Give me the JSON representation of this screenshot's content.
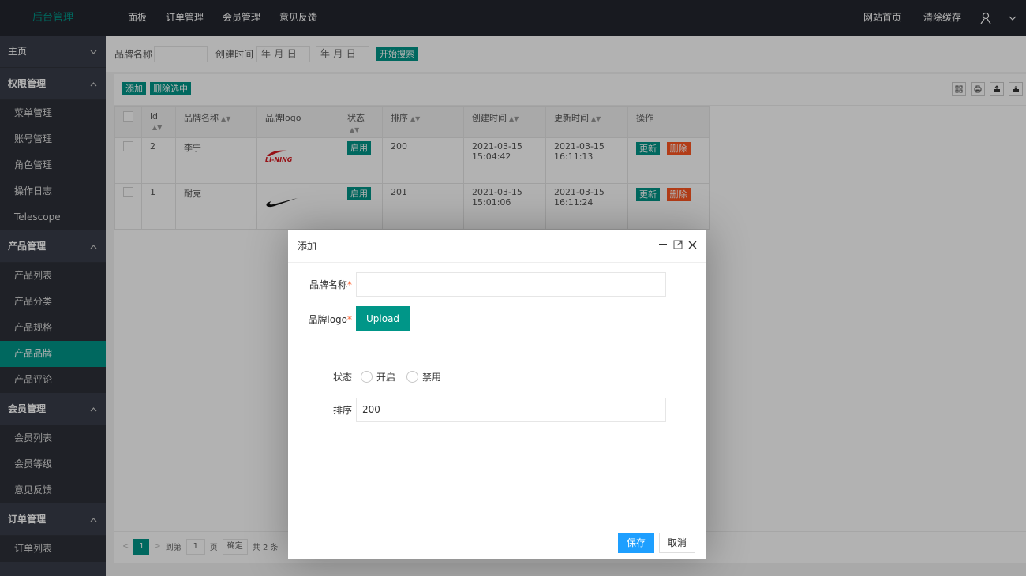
{
  "header": {
    "brand": "后台管理",
    "nav": [
      "面板",
      "订单管理",
      "会员管理",
      "意见反馈"
    ],
    "right_links": [
      "网站首页",
      "清除缓存"
    ]
  },
  "sidebar": {
    "home": "主页",
    "groups": [
      {
        "label": "权限管理",
        "items": [
          "菜单管理",
          "账号管理",
          "角色管理",
          "操作日志",
          "Telescope"
        ]
      },
      {
        "label": "产品管理",
        "items": [
          "产品列表",
          "产品分类",
          "产品规格",
          "产品品牌",
          "产品评论"
        ]
      },
      {
        "label": "会员管理",
        "items": [
          "会员列表",
          "会员等级",
          "意见反馈"
        ]
      },
      {
        "label": "订单管理",
        "items": [
          "订单列表"
        ]
      }
    ]
  },
  "search": {
    "name_label": "品牌名称",
    "name_value": "",
    "time_label": "创建时间",
    "date_placeholder_1": "年-月-日",
    "date_placeholder_2": "年-月-日",
    "search_button": "开始搜索"
  },
  "toolbar": {
    "add_label": "添加",
    "delete_selected_label": "删除选中"
  },
  "table": {
    "columns": [
      "id",
      "品牌名称",
      "品牌logo",
      "状态",
      "排序",
      "创建时间",
      "更新时间",
      "操作"
    ],
    "rows": [
      {
        "id": "2",
        "name": "李宁",
        "logo": "LI-NING",
        "status": "启用",
        "sort": "200",
        "created": "2021-03-15 15:04:42",
        "updated": "2021-03-15 16:11:13",
        "update_btn": "更新",
        "delete_btn": "删除"
      },
      {
        "id": "1",
        "name": "耐克",
        "logo": "nike-swoosh",
        "status": "启用",
        "sort": "201",
        "created": "2021-03-15 15:01:06",
        "updated": "2021-03-15 16:11:24",
        "update_btn": "更新",
        "delete_btn": "删除"
      }
    ]
  },
  "pager": {
    "current": "1",
    "goto_label": "到第",
    "page_value": "1",
    "page_unit": "页",
    "confirm": "确定",
    "total": "共 2 条"
  },
  "modal": {
    "title": "添加",
    "brand_name_label": "品牌名称",
    "brand_name_value": "",
    "logo_label": "品牌logo",
    "upload_label": "Upload",
    "status_label": "状态",
    "status_options": [
      "开启",
      "禁用"
    ],
    "sort_label": "排序",
    "sort_value": "200",
    "save_label": "保存",
    "cancel_label": "取消",
    "required_mark": "*"
  },
  "colors": {
    "accent": "#009688",
    "danger": "#ff5722",
    "primary": "#1e9fff",
    "sidebar_bg": "#393d49",
    "header_bg": "#23262e"
  }
}
